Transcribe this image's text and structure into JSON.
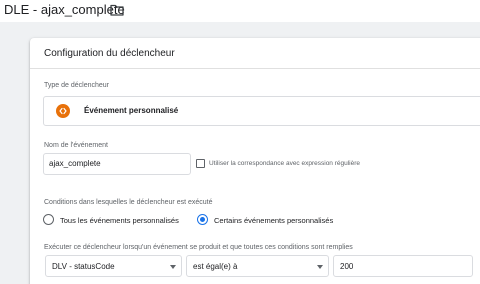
{
  "header": {
    "title": "DLE - ajax_complete",
    "folder_icon": "folder-icon"
  },
  "card": {
    "title": "Configuration du déclencheur",
    "trigger_type": {
      "label": "Type de déclencheur",
      "name": "Événement personnalisé",
      "icon": "custom-event-icon",
      "icon_color": "#e8710a"
    },
    "event_name": {
      "label": "Nom de l'événement",
      "value": "ajax_complete",
      "regex_label": "Utiliser la correspondance avec expression régulière",
      "regex_checked": false
    },
    "conditions": {
      "label": "Conditions dans lesquelles le déclencheur est exécuté",
      "options": [
        "Tous les événements personnalisés",
        "Certains événements personnalisés"
      ],
      "selected": "Certains événements personnalisés"
    },
    "filter": {
      "label": "Exécuter ce déclencheur lorsqu'un événement se produit et que toutes ces conditions sont remplies",
      "variable": "DLV - statusCode",
      "operator": "est égal(e) à",
      "value": "200"
    }
  },
  "colors": {
    "accent": "#1a73e8",
    "background": "#eff1f3"
  }
}
